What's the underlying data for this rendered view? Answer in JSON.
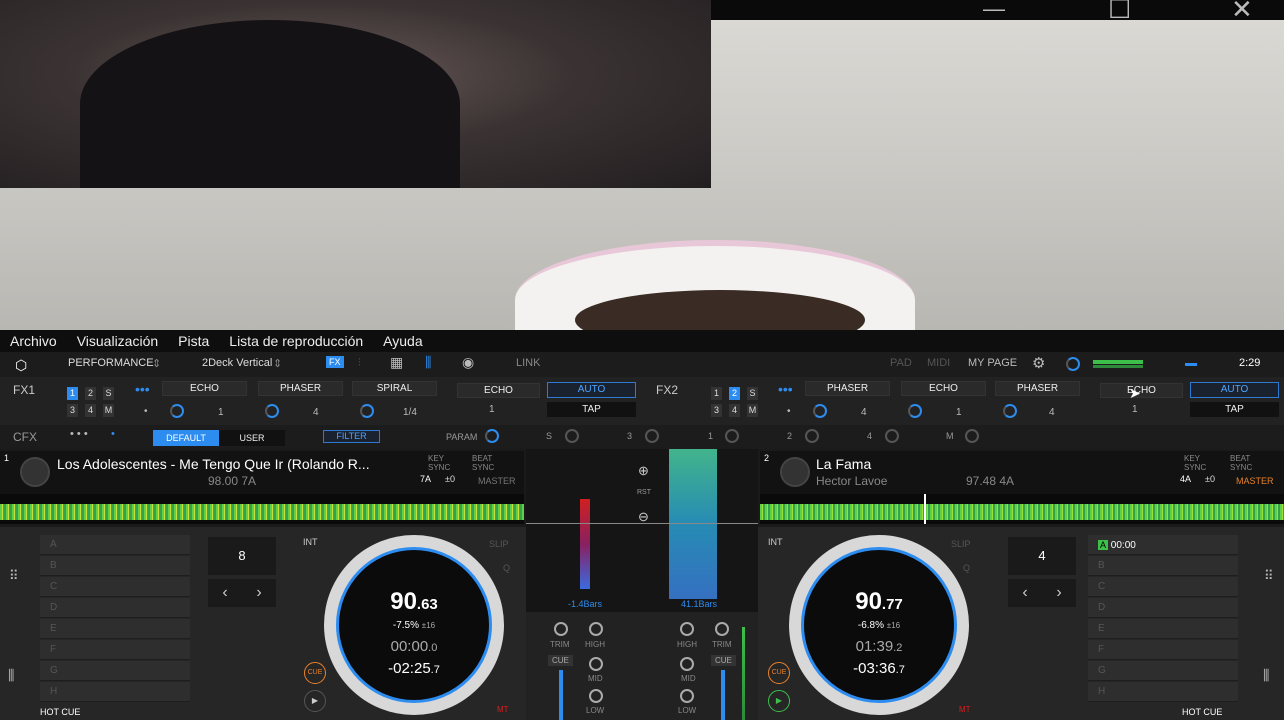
{
  "window": {
    "minimize": "—",
    "maximize": "☐",
    "close": "✕"
  },
  "menu": [
    "Archivo",
    "Visualización",
    "Pista",
    "Lista de reproducción",
    "Ayuda"
  ],
  "toolbar": {
    "mode": "PERFORMANCE",
    "layout": "2Deck Vertical",
    "fx": "FX",
    "link": "LINK",
    "pad": "PAD",
    "midi": "MIDI",
    "mypage": "MY PAGE",
    "time": "2:29"
  },
  "fx1": {
    "label": "FX1",
    "nums": [
      "1",
      "2",
      "S",
      "3",
      "4",
      "M"
    ],
    "effects": [
      "ECHO",
      "PHASER",
      "SPIRAL",
      "ECHO"
    ],
    "values": [
      "1",
      "4",
      "1/4",
      "1"
    ],
    "auto": "AUTO",
    "tap": "TAP"
  },
  "fx2": {
    "label": "FX2",
    "nums": [
      "1",
      "2",
      "S",
      "3",
      "4",
      "M"
    ],
    "effects": [
      "PHASER",
      "ECHO",
      "PHASER",
      "ECHO"
    ],
    "values": [
      "4",
      "1",
      "4",
      "1"
    ],
    "auto": "AUTO",
    "tap": "TAP"
  },
  "cfx": {
    "label": "CFX",
    "default": "DEFAULT",
    "user": "USER",
    "filter": "FILTER",
    "param": "PARAM",
    "knobs": [
      "S",
      "3",
      "1",
      "2",
      "4",
      "M"
    ]
  },
  "deck1": {
    "num": "1",
    "title": "Los Adolescentes - Me Tengo Que Ir (Rolando R...",
    "bpm_key": "98.00 7A",
    "keysync": "KEY SYNC",
    "key": "7A",
    "offset": "±0",
    "beatsync": "BEAT SYNC",
    "master": "MASTER",
    "cues": [
      "A",
      "B",
      "C",
      "D",
      "E",
      "F",
      "G",
      "H"
    ],
    "loop": "8",
    "int": "INT",
    "slip": "SLIP",
    "q": "Q",
    "bpm_main": "90",
    "bpm_dec": ".63",
    "pitch": "-7.5%",
    "range": "±16",
    "elapsed": "00:00",
    "elapsed_dec": ".0",
    "remain": "-02:25",
    "remain_dec": ".7",
    "cue": "CUE",
    "hotcue": "HOT CUE",
    "mt": "MT"
  },
  "deck2": {
    "num": "2",
    "title": "La Fama",
    "artist": "Hector Lavoe",
    "bpm_key": "97.48 4A",
    "keysync": "KEY SYNC",
    "key": "4A",
    "offset": "±0",
    "beatsync": "BEAT SYNC",
    "master": "MASTER",
    "cue1_label": "A",
    "cue1_time": "00:00",
    "cues": [
      "B",
      "C",
      "D",
      "E",
      "F",
      "G",
      "H"
    ],
    "loop": "4",
    "int": "INT",
    "slip": "SLIP",
    "q": "Q",
    "bpm_main": "90",
    "bpm_dec": ".77",
    "pitch": "-6.8%",
    "range": "±16",
    "elapsed": "01:39",
    "elapsed_dec": ".2",
    "remain": "-03:36",
    "remain_dec": ".7",
    "cue": "CUE",
    "hotcue": "HOT CUE",
    "mt": "MT"
  },
  "center": {
    "rst": "RST",
    "left_bars": "-1.4Bars",
    "right_bars": "41.1Bars"
  },
  "mixer": {
    "trim": "TRIM",
    "high": "HIGH",
    "cue": "CUE",
    "mid": "MID",
    "low": "LOW"
  }
}
